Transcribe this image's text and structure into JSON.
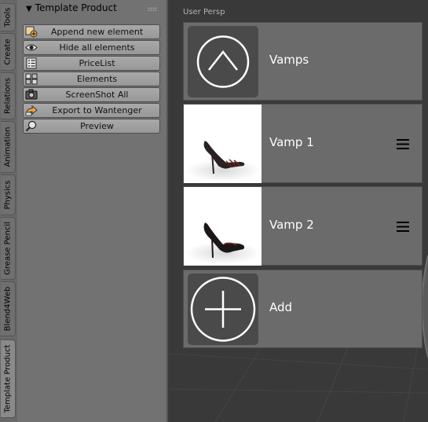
{
  "tabs": [
    "Tools",
    "Create",
    "Relations",
    "Animation",
    "Physics",
    "Grease Pencil",
    "Blend4Web",
    "Template Product"
  ],
  "active_tab": "Template Product",
  "panel": {
    "title": "Template Product",
    "buttons": [
      {
        "label": "Append new element",
        "icon": "append-element-icon"
      },
      {
        "label": "Hide all elements",
        "icon": "eye-icon"
      },
      {
        "label": "PriceList",
        "icon": "list-icon"
      },
      {
        "label": "Elements",
        "icon": "elements-icon"
      },
      {
        "label": "ScreenShot All",
        "icon": "camera-icon"
      },
      {
        "label": "Export to Wantenger",
        "icon": "export-icon"
      },
      {
        "label": "Preview",
        "icon": "preview-icon"
      }
    ]
  },
  "viewport": {
    "label": "User Persp",
    "cards": [
      {
        "name": "Vamps",
        "thumb": "chevron-up-icon"
      },
      {
        "name": "Vamp 1",
        "thumb": "sandal-thumbnail",
        "menu_icon": "hamburger-menu-icon"
      },
      {
        "name": "Vamp 2",
        "thumb": "sandal-thumbnail",
        "menu_icon": "hamburger-menu-icon"
      },
      {
        "name": "Add",
        "thumb": "plus-icon"
      }
    ]
  }
}
